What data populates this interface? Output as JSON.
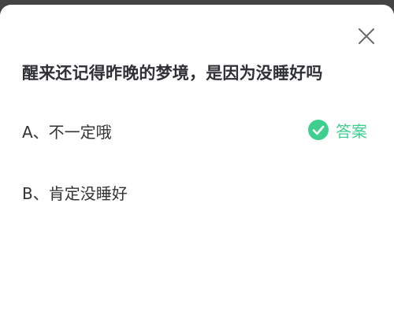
{
  "quiz": {
    "question": "醒来还记得昨晚的梦境，是因为没睡好吗",
    "options": [
      {
        "label": "A、不一定哦",
        "is_answer": true
      },
      {
        "label": "B、肯定没睡好",
        "is_answer": false
      }
    ],
    "answer_label": "答案",
    "close_icon": "close-icon",
    "check_icon": "check-circle-icon",
    "colors": {
      "accent": "#3ecf8e",
      "question_text": "#2f3136",
      "option_text": "#333333",
      "backdrop": "#444444"
    }
  }
}
